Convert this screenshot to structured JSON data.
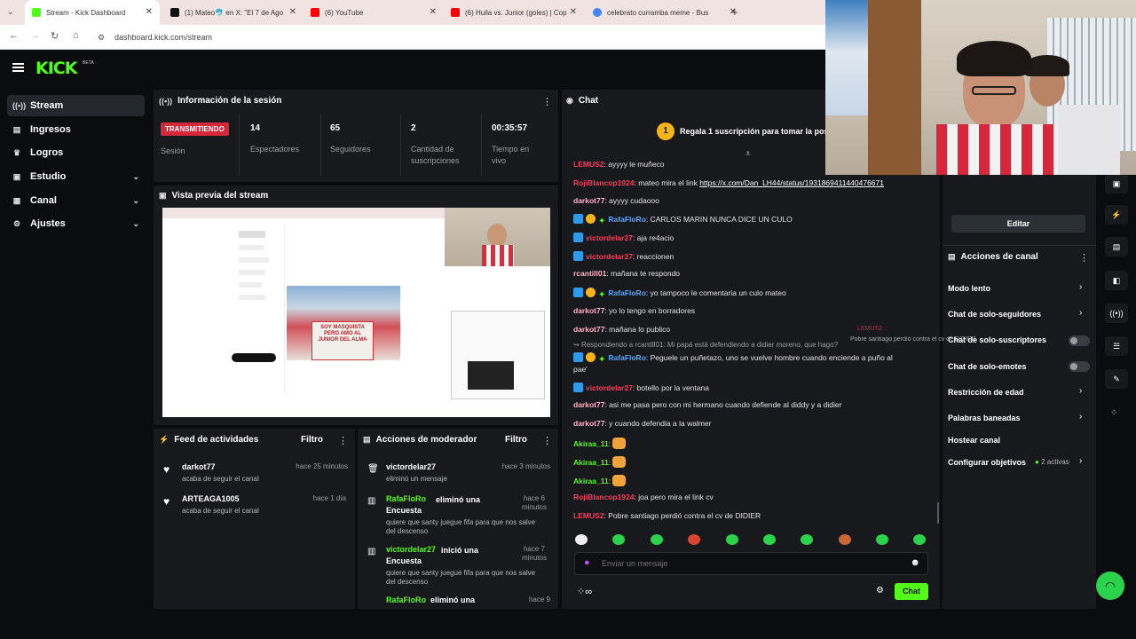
{
  "browser": {
    "tabs": [
      {
        "title": "Stream - Kick Dashboard",
        "color": "#53fc18"
      },
      {
        "title": "(1) Mateo🐬 en X: \"El 7 de Ago",
        "color": "#111111"
      },
      {
        "title": "(6) YouTube",
        "color": "#ff0000"
      },
      {
        "title": "(6) Huila vs. Junior (goles) | Cop",
        "color": "#ff0000"
      },
      {
        "title": "celebrato curramba meme - Bus",
        "color": "#4285f4"
      }
    ],
    "new_tab": "+",
    "url": "dashboard.kick.com/stream"
  },
  "brand": {
    "logo": "KICK",
    "beta": "BETA",
    "accent": "#53fc18"
  },
  "sidebar": {
    "items": [
      {
        "label": "Stream",
        "icon": "stream-icon"
      },
      {
        "label": "Ingresos",
        "icon": "chart-icon"
      },
      {
        "label": "Logros",
        "icon": "trophy-icon"
      },
      {
        "label": "Estudio",
        "icon": "studio-icon"
      },
      {
        "label": "Canal",
        "icon": "channel-icon"
      },
      {
        "label": "Ajustes",
        "icon": "gear-icon"
      }
    ]
  },
  "session": {
    "title": "Información de la sesión",
    "status": "TRANSMITIENDO",
    "status_label": "Sesión",
    "stats": [
      {
        "value": "14",
        "label": "Espectadores"
      },
      {
        "value": "65",
        "label": "Seguidores"
      },
      {
        "value": "2",
        "label": "Cantidad de suscripciones"
      },
      {
        "value": "00:35:57",
        "label": "Tiempo en vivo"
      }
    ]
  },
  "preview": {
    "title": "Vista previa del stream",
    "post_caption": "SOY MASQUISTA PERO AMO AL JUNIOR DEL ALMA"
  },
  "feed": {
    "title": "Feed de actividades",
    "filter": "Filtro",
    "items": [
      {
        "name": "darkot77",
        "desc": "acaba de seguir el canal",
        "time": "hace 25 minutos"
      },
      {
        "name": "ARTEAGA1005",
        "desc": "acaba de seguir el canal",
        "time": "hace 1 día"
      }
    ]
  },
  "mod": {
    "title": "Acciones de moderador",
    "filter": "Filtro",
    "items": [
      {
        "name": "victordelar27",
        "action": "",
        "desc": "eliminó un mensaje",
        "time": "hace 3 minutos"
      },
      {
        "name": "RafaFloRo",
        "action": "eliminó una Encuesta",
        "desc": "quiere que santy juegue fifa para que nos salve del descenso",
        "time": "hace 6 minutos"
      },
      {
        "name": "victordelar27",
        "action": "inició una Encuesta",
        "desc": "quiere que santy juegue fifa para que nos salve del descenso",
        "time": "hace 7 minutos"
      },
      {
        "name": "RafaFloRo",
        "action": "eliminó una",
        "desc": "",
        "time": "hace 9"
      }
    ]
  },
  "chat": {
    "title": "Chat",
    "pinned": "Regala 1 suscripción para tomar la posic",
    "pinned_count": "1",
    "messages": [
      {
        "user": "LEMUS2",
        "color": "#ff3b5c",
        "text": "ayyyy le muñeco"
      },
      {
        "user": "RojiBlancop1924",
        "color": "#ff3b5c",
        "text": "mateo mira el link ",
        "link": "https://x.com/Dan_LH44/status/1931869411440476671"
      },
      {
        "user": "darkot77",
        "color": "#ffb3c6",
        "text": "ayyyy cudaooo"
      },
      {
        "user": "RafaFloRo",
        "color": "#5aa7ff",
        "text": "CARLOS MARIN NUNCA DICE UN CULO",
        "badges": true
      },
      {
        "user": "victordelar27",
        "color": "#ff3b5c",
        "text": "aja re4acio",
        "badge": true
      },
      {
        "user": "victordelar27",
        "color": "#ff3b5c",
        "text": "reaccionen",
        "badge": true
      },
      {
        "user": "rcantill01",
        "color": "#ffb3c6",
        "text": "mañana te respondo"
      },
      {
        "user": "RafaFloRo",
        "color": "#5aa7ff",
        "text": "yo tampoco le comentaria un culo mateo",
        "badges": true
      },
      {
        "user": "darkot77",
        "color": "#ffb3c6",
        "text": "yo lo tengo en borradores"
      },
      {
        "user": "darkot77",
        "color": "#ffb3c6",
        "text": "mañana lo publico"
      },
      {
        "reply": "Respondiendo a rcantill01: Mi papá está defendiendo a didier moreno, que hago?"
      },
      {
        "user": "RafaFloRo",
        "color": "#5aa7ff",
        "text": "Peguele un puñetazo, uno se vuelve hombre cuando enciende a puño al",
        "text2": "pae'",
        "badges": true
      },
      {
        "user": "victordelar27",
        "color": "#ff3b5c",
        "text": "botello por la ventana",
        "badge": true
      },
      {
        "user": "darkot77",
        "color": "#ffb3c6",
        "text": "asi me pasa pero con mi hermano cuando defiende al diddy y a didier"
      },
      {
        "user": "darkot77",
        "color": "#ffb3c6",
        "text": "y cuando defendia a la walmer"
      },
      {
        "user": "Akiraa_11",
        "color": "#53fc18",
        "emote": true
      },
      {
        "user": "Akiraa_11",
        "color": "#53fc18",
        "emote": true
      },
      {
        "user": "Akiraa_11",
        "color": "#53fc18",
        "emote": true
      },
      {
        "user": "RojiBlancop1924",
        "color": "#ff3b5c",
        "text": "joa pero mira el link cv"
      },
      {
        "user": "LEMUS2",
        "color": "#ff3b5c",
        "text": "Pobre santiago perdió contra el cv de DIDIER"
      }
    ],
    "input_placeholder": "Enviar un mensaje",
    "send": "Chat",
    "overlay_name": "LEMUS2",
    "overlay_text": "Pobre santiago perdió contra el cv de DIDIER"
  },
  "right": {
    "edit": "Editar",
    "actions_title": "Acciones de canal",
    "items": [
      {
        "label": "Modo lento",
        "kind": "chevron"
      },
      {
        "label": "Chat de solo-seguidores",
        "kind": "chevron"
      },
      {
        "label": "Chat de solo-suscriptores",
        "kind": "toggle"
      },
      {
        "label": "Chat de solo-emotes",
        "kind": "toggle"
      },
      {
        "label": "Restricción de edad",
        "kind": "chevron"
      },
      {
        "label": "Palabras baneadas",
        "kind": "chevron"
      },
      {
        "label": "Hostear canal",
        "kind": "none"
      },
      {
        "label": "Configurar objetivos",
        "kind": "chevron",
        "extra": "2 activas"
      }
    ]
  }
}
